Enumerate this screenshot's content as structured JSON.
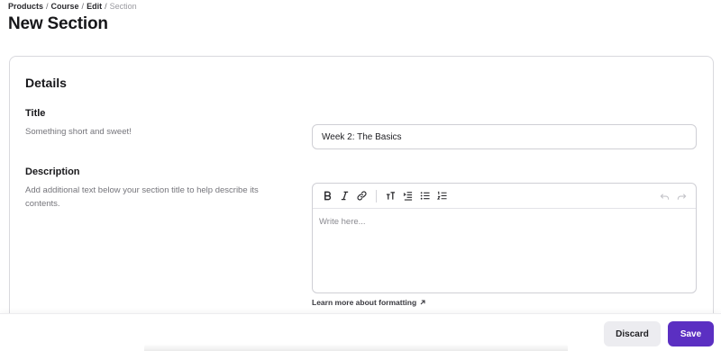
{
  "breadcrumb": {
    "items": [
      "Products",
      "Course",
      "Edit"
    ],
    "current": "Section",
    "separator": "/"
  },
  "page": {
    "title": "New Section"
  },
  "details": {
    "heading": "Details",
    "title_field": {
      "label": "Title",
      "help": "Something short and sweet!",
      "value": "Week 2: The Basics"
    },
    "description_field": {
      "label": "Description",
      "help": "Add additional text below your section title to help describe its contents.",
      "placeholder": "Write here..."
    },
    "toolbar": [
      "bold-icon",
      "italic-icon",
      "link-icon",
      "text-size-icon",
      "indent-icon",
      "bullet-list-icon",
      "numbered-list-icon",
      "undo-icon",
      "redo-icon"
    ],
    "help_link": "Learn more about formatting"
  },
  "footer": {
    "discard_label": "Discard",
    "save_label": "Save"
  },
  "colors": {
    "accent": "#5b2fc2",
    "secondary_button": "#ececf0",
    "border": "#d9d9de"
  }
}
